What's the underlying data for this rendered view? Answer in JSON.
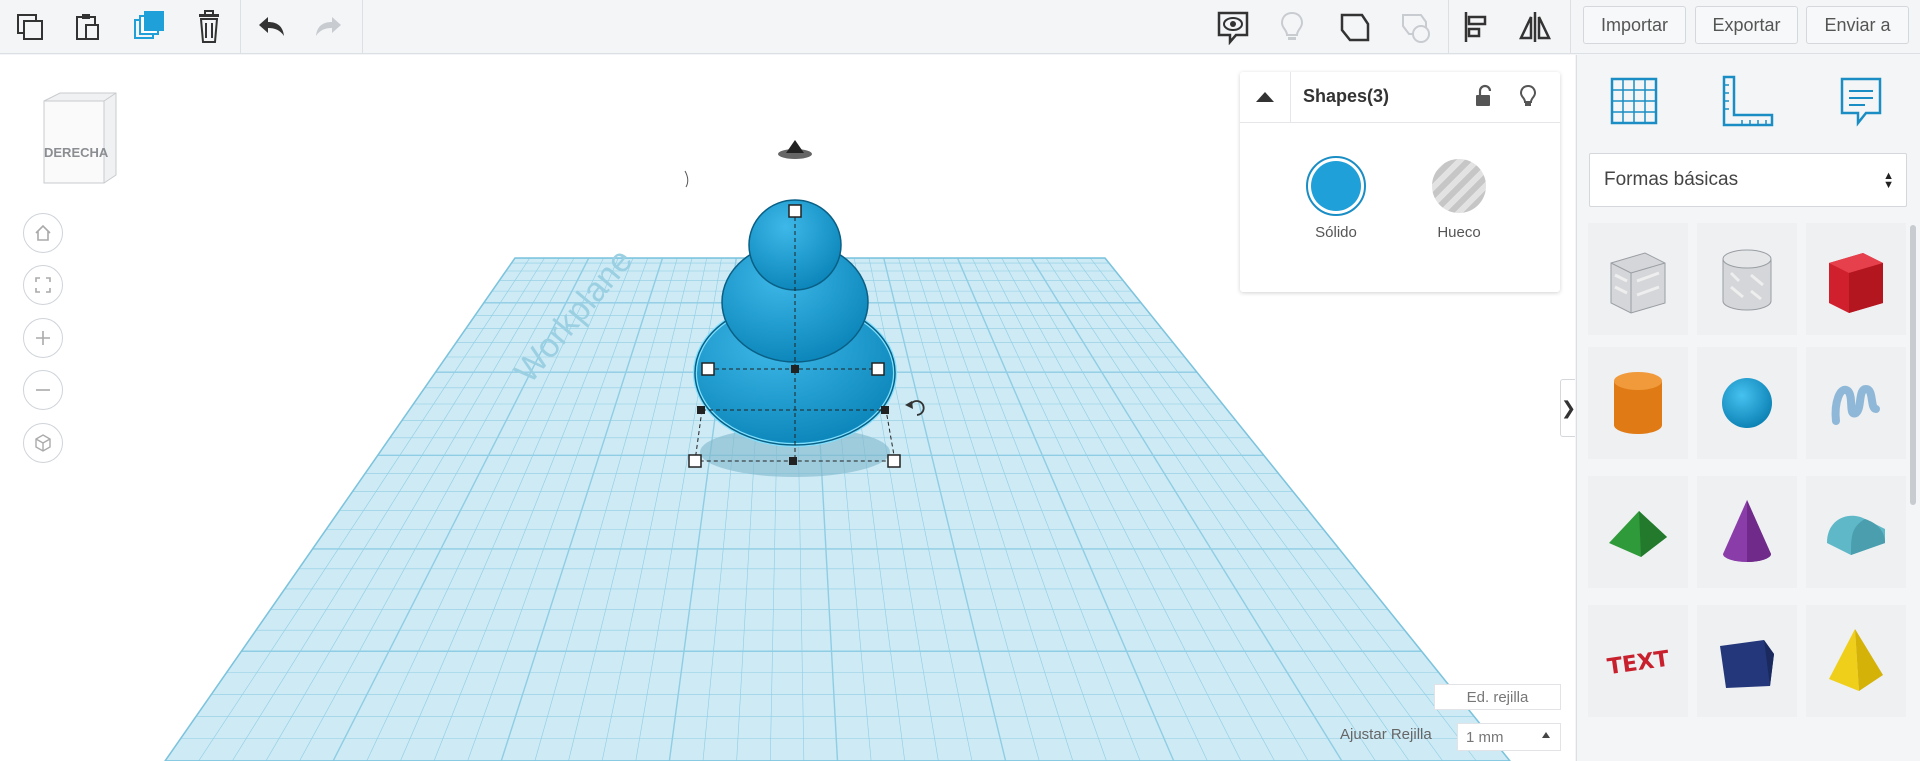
{
  "toolbar": {
    "import_label": "Importar",
    "export_label": "Exportar",
    "send_label": "Enviar a",
    "icons": [
      "copy-icon",
      "paste-icon",
      "duplicate-icon",
      "trash-icon",
      "undo-icon",
      "redo-icon",
      "notes-eye-icon",
      "lightbulb-icon",
      "workplane-icon",
      "ruler-icon",
      "align-icon",
      "mirror-icon"
    ]
  },
  "viewcube": {
    "face_label": "DERECHA"
  },
  "inspector": {
    "title": "Shapes(3)",
    "solid_label": "Sólido",
    "hole_label": "Hueco"
  },
  "workplane": {
    "watermark": "Workplane",
    "edit_grid_label": "Ed. rejilla",
    "snap_grid_label": "Ajustar Rejilla",
    "snap_grid_value": "1 mm"
  },
  "library": {
    "category": "Formas básicas",
    "shapes": [
      "box-hole",
      "cylinder-hole",
      "box",
      "cylinder",
      "sphere",
      "scribble",
      "roof",
      "cone",
      "round-roof",
      "text",
      "wedge",
      "pyramid"
    ]
  },
  "colors": {
    "accent": "#1fa0d8",
    "shape_blue": "#1596cc",
    "grid": "#a9dcee"
  }
}
